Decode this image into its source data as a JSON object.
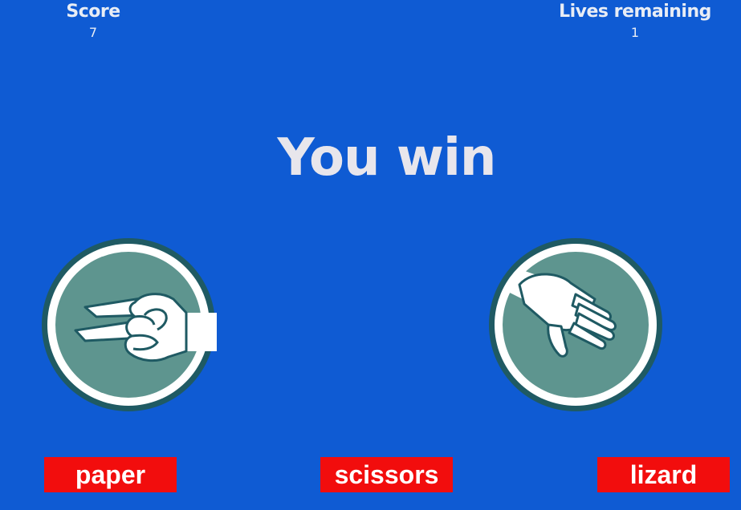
{
  "score": {
    "label": "Score",
    "value": "7"
  },
  "lives": {
    "label": "Lives remaining",
    "value": "1"
  },
  "result": "You win",
  "player_hand": {
    "gesture": "scissors",
    "icon": "scissors-hand-icon"
  },
  "cpu_hand": {
    "gesture": "paper",
    "icon": "paper-hand-icon"
  },
  "choices": [
    {
      "label": "paper"
    },
    {
      "label": "scissors"
    },
    {
      "label": "lizard"
    }
  ],
  "colors": {
    "background": "#0f5bd3",
    "button": "#f20d0d",
    "icon_fill": "#5e958f",
    "icon_border": "#1f5a63",
    "text": "#e8e6ec"
  }
}
